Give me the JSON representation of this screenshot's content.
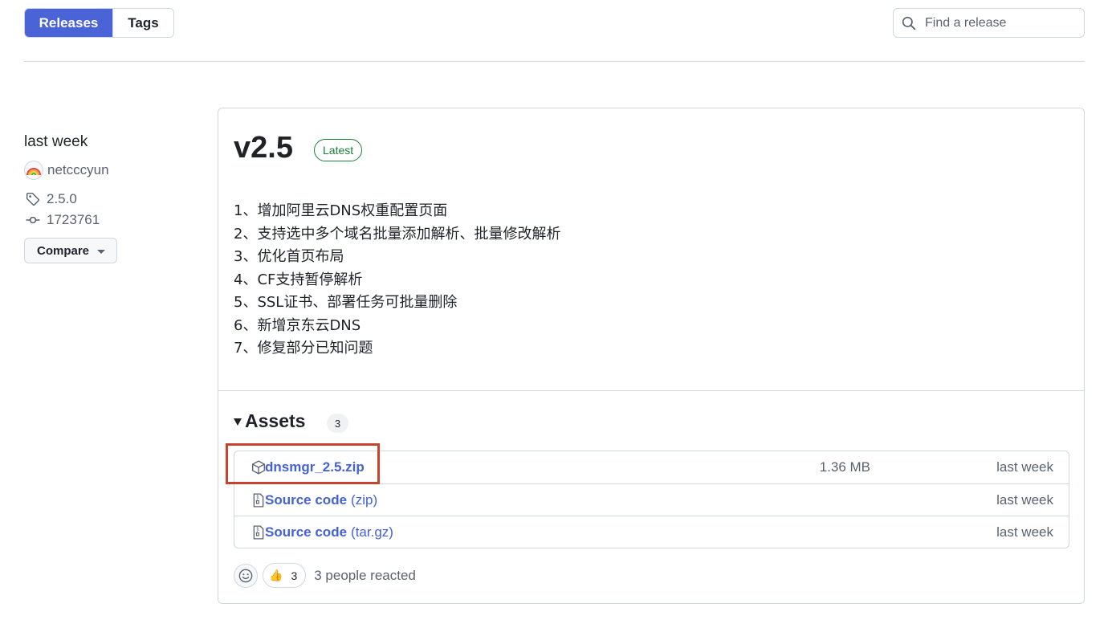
{
  "tabs": {
    "releases": "Releases",
    "tags": "Tags"
  },
  "search": {
    "placeholder": "Find a release"
  },
  "meta": {
    "time": "last week",
    "author": "netcccyun",
    "tag": "2.5.0",
    "commit": "1723761",
    "compare_label": "Compare"
  },
  "release": {
    "title": "v2.5",
    "badge": "Latest",
    "notes": [
      "1、增加阿里云DNS权重配置页面",
      "2、支持选中多个域名批量添加解析、批量修改解析",
      "3、优化首页布局",
      "4、CF支持暂停解析",
      "5、SSL证书、部署任务可批量删除",
      "6、新增京东云DNS",
      "7、修复部分已知问题"
    ]
  },
  "assets": {
    "heading": "Assets",
    "count": "3",
    "items": [
      {
        "name": "dnsmgr_2.5.zip",
        "ext": "",
        "size": "1.36 MB",
        "date": "last week",
        "icon": "package-icon"
      },
      {
        "name": "Source code",
        "ext": "(zip)",
        "size": "",
        "date": "last week",
        "icon": "file-zip-icon"
      },
      {
        "name": "Source code",
        "ext": "(tar.gz)",
        "size": "",
        "date": "last week",
        "icon": "file-zip-icon"
      }
    ]
  },
  "reactions": {
    "thumbs_count": "3",
    "summary": "3 people reacted"
  },
  "colors": {
    "accent": "#4a63d6",
    "link": "#4461d6",
    "latest_green": "#1a7f37",
    "highlight": "#c8432b"
  }
}
